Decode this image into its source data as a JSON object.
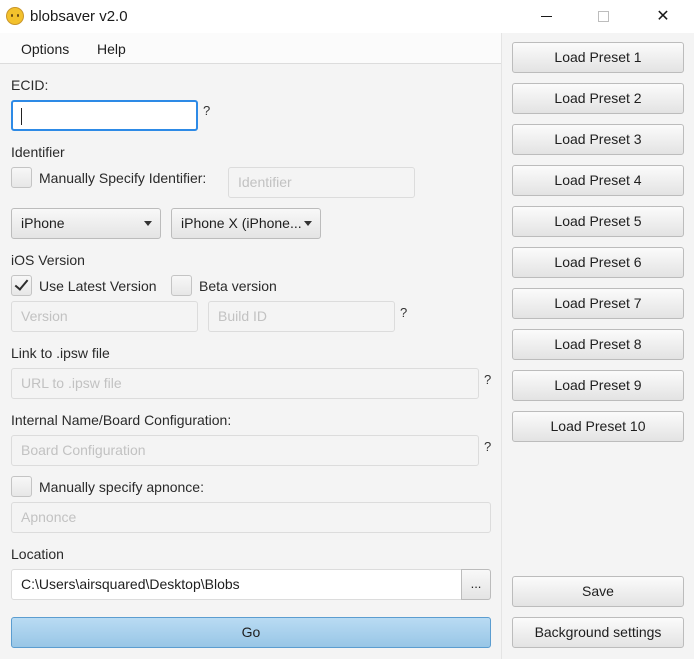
{
  "window": {
    "title": "blobsaver v2.0",
    "minimize": "—",
    "maximize": "☐",
    "close": "✕",
    "icon": "blob-icon"
  },
  "menu": {
    "items": [
      "Options",
      "Help"
    ]
  },
  "ecid": {
    "label": "ECID:",
    "value": "",
    "help": "?"
  },
  "identifier": {
    "section_label": "Identifier",
    "manual_label": "Manually Specify Identifier:",
    "manual_checked": false,
    "placeholder": "Identifier"
  },
  "device": {
    "type_value": "iPhone",
    "model_value": "iPhone X (iPhone..."
  },
  "ios": {
    "section_label": "iOS Version",
    "use_latest_label": "Use Latest Version",
    "use_latest_checked": true,
    "beta_label": "Beta version",
    "beta_checked": false,
    "version_placeholder": "Version",
    "build_placeholder": "Build ID",
    "help": "?"
  },
  "ipsw": {
    "label": "Link to .ipsw file",
    "placeholder": "URL to .ipsw file",
    "help": "?"
  },
  "board": {
    "label": "Internal Name/Board Configuration:",
    "placeholder": "Board Configuration",
    "help": "?"
  },
  "apnonce": {
    "label": "Manually specify apnonce:",
    "checked": false,
    "placeholder": "Apnonce"
  },
  "location": {
    "label": "Location",
    "value": "C:\\Users\\airsquared\\Desktop\\Blobs",
    "browse_label": "..."
  },
  "go_label": "Go",
  "presets": [
    "Load Preset 1",
    "Load Preset 2",
    "Load Preset 3",
    "Load Preset 4",
    "Load Preset 5",
    "Load Preset 6",
    "Load Preset 7",
    "Load Preset 8",
    "Load Preset 9",
    "Load Preset 10"
  ],
  "save_label": "Save",
  "background_label": "Background settings"
}
